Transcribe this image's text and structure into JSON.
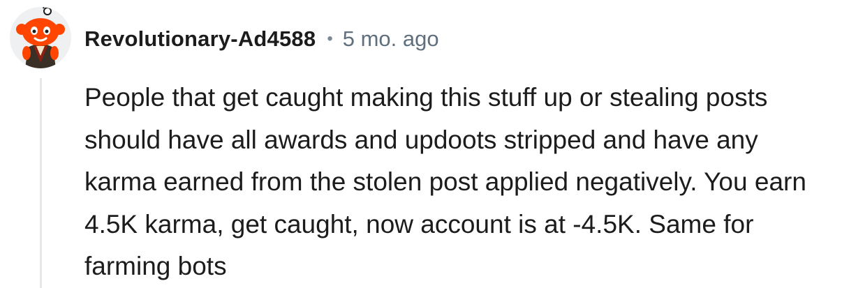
{
  "comment": {
    "author": {
      "username": "Revolutionary-Ad4588",
      "avatar_icon": "snoo-avatar-icon"
    },
    "separator": "•",
    "timestamp": "5 mo. ago",
    "body": "People that get caught making this stuff up or stealing posts should have all awards and updoots stripped and have any karma earned from the stolen post applied negatively. You earn 4.5K karma, get caught, now account is at -4.5K. Same for farming bots"
  },
  "colors": {
    "avatar_head": "#ff4500",
    "username_text": "#1c1c1c",
    "meta_text": "#5f6f7d",
    "thread_line": "#e5e7ea"
  }
}
